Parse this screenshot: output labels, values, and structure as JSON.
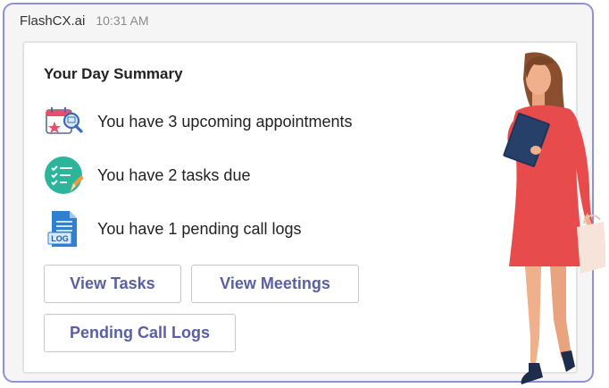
{
  "message": {
    "sender": "FlashCX.ai",
    "time": "10:31 AM"
  },
  "card": {
    "title": "Your Day Summary",
    "items": [
      {
        "icon": "calendar-search-icon",
        "text": "You have 3 upcoming appointments"
      },
      {
        "icon": "task-checklist-icon",
        "text": "You have 2 tasks due"
      },
      {
        "icon": "log-document-icon",
        "text": "You have 1 pending call logs",
        "icon_label": "LOG"
      }
    ],
    "buttons": {
      "view_tasks": "View Tasks",
      "view_meetings": "View Meetings",
      "pending_call_logs": "Pending Call Logs"
    }
  },
  "colors": {
    "frame_border": "#8d92d8",
    "button_text": "#5a5fa4",
    "dress": "#e84b4b",
    "task_icon_bg": "#2db59b"
  }
}
